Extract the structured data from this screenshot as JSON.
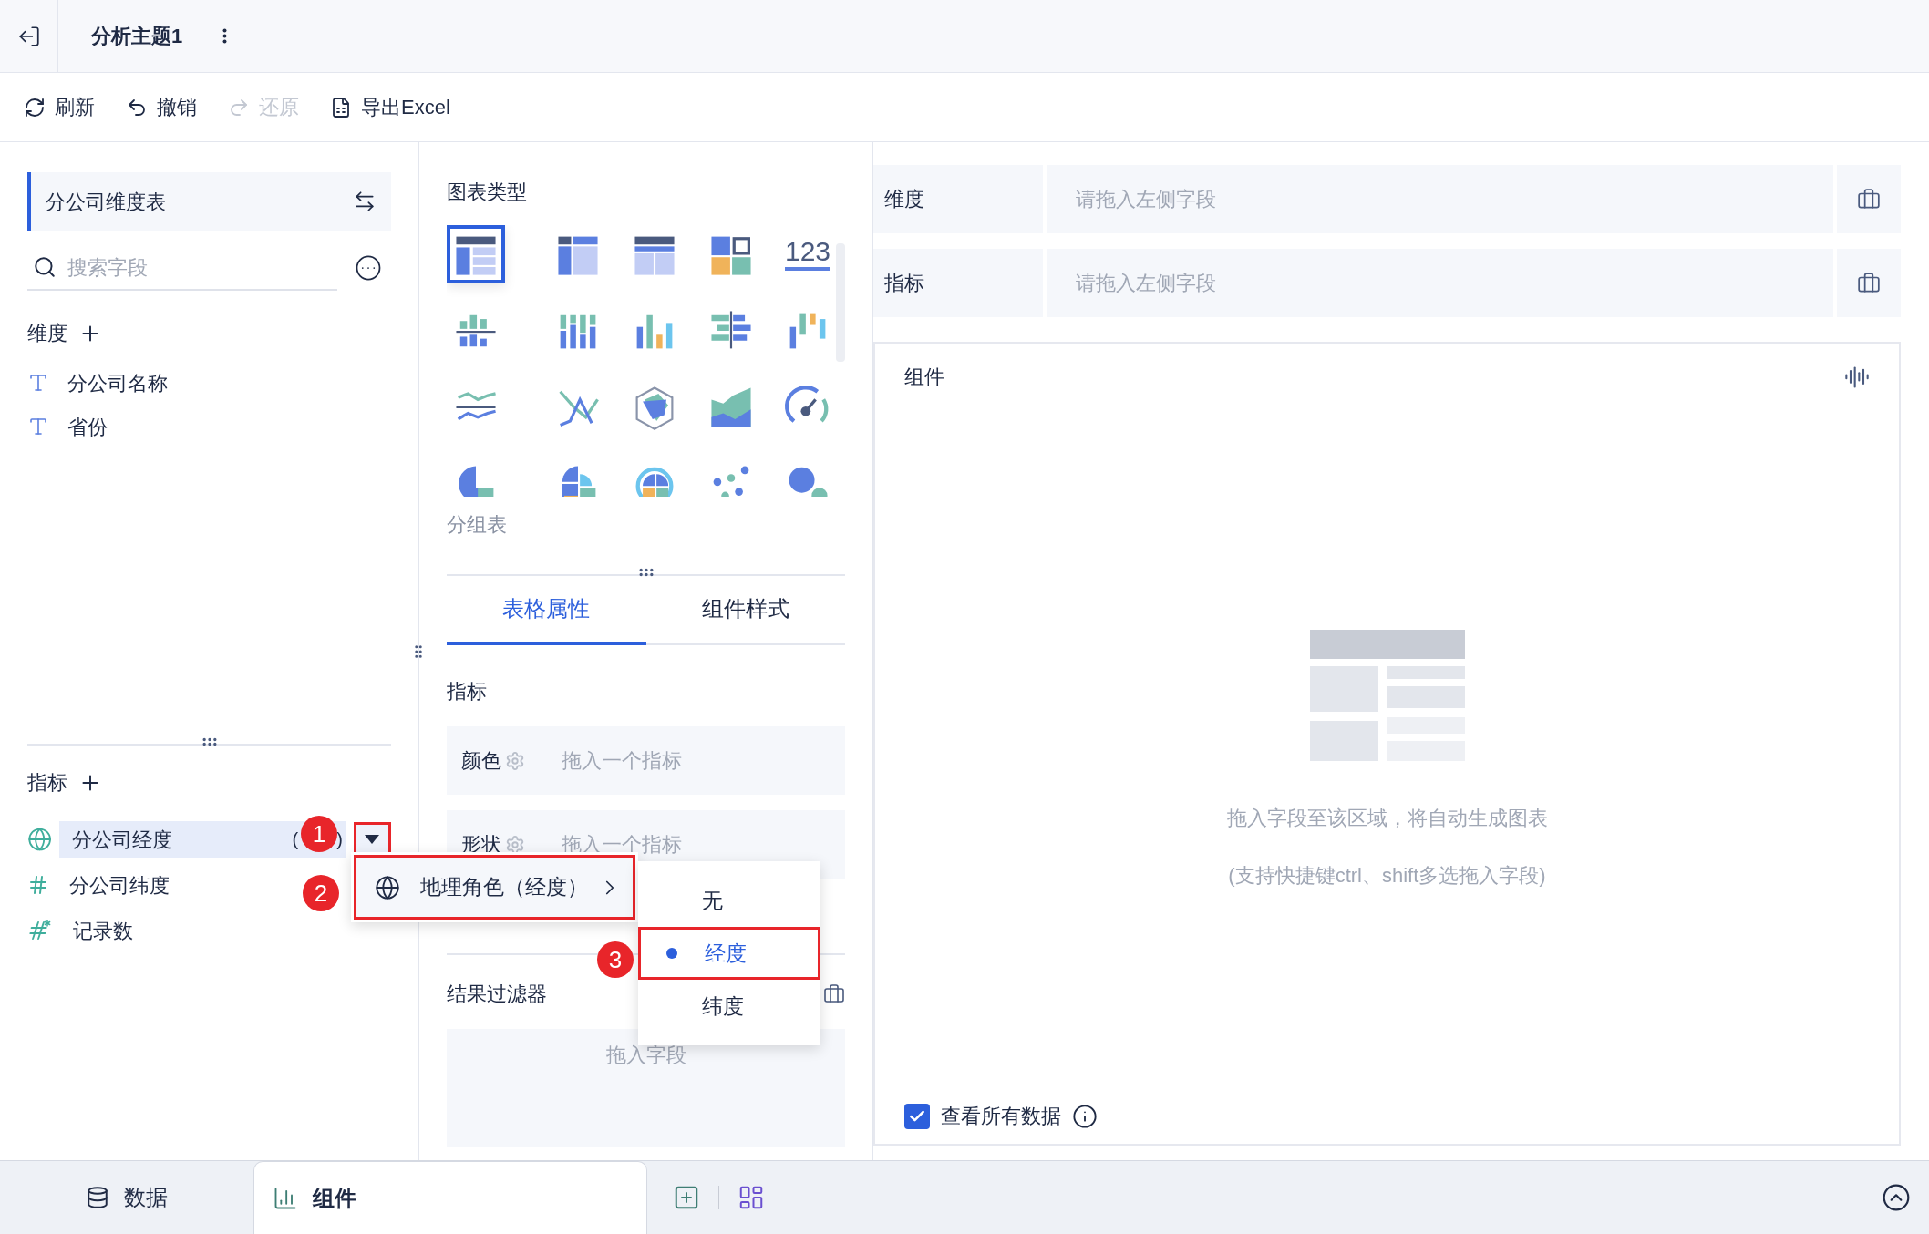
{
  "header": {
    "title": "分析主题1"
  },
  "toolbar": [
    {
      "kind": "refresh",
      "label": "刷新",
      "disabled": false
    },
    {
      "kind": "undo",
      "label": "撤销",
      "disabled": false
    },
    {
      "kind": "redo",
      "label": "还原",
      "disabled": true
    },
    {
      "kind": "excel",
      "label": "导出Excel",
      "disabled": false
    }
  ],
  "fields_panel": {
    "dataset": "分公司维度表",
    "search": {
      "placeholder": "搜索字段"
    },
    "dimensions": {
      "title": "维度",
      "fields": [
        {
          "kind": "text",
          "name": "分公司名称"
        },
        {
          "kind": "text",
          "name": "省份"
        }
      ]
    },
    "measures": {
      "title": "指标",
      "fields": [
        {
          "kind": "geo",
          "name": "分公司经度",
          "suffix_open": "(",
          "suffix_close": ")",
          "selected": true
        },
        {
          "kind": "number",
          "name": "分公司纬度",
          "selected": false
        },
        {
          "kind": "count",
          "name": "记录数",
          "selected": false
        }
      ]
    }
  },
  "chart_types": {
    "title": "图表类型",
    "caption": "分组表",
    "items": [
      {
        "kind": "table",
        "selected": true
      },
      {
        "kind": "crosstab",
        "selected": false
      },
      {
        "kind": "detail",
        "selected": false
      },
      {
        "kind": "card",
        "selected": false
      },
      {
        "kind": "kpi",
        "label": "123",
        "selected": false
      },
      {
        "kind": "bar-split",
        "selected": false
      },
      {
        "kind": "bar-stacked",
        "selected": false
      },
      {
        "kind": "column",
        "selected": false
      },
      {
        "kind": "bar-horizontal",
        "selected": false
      },
      {
        "kind": "waterfall",
        "selected": false
      },
      {
        "kind": "line-compare",
        "selected": false
      },
      {
        "kind": "line-cross",
        "selected": false
      },
      {
        "kind": "radar",
        "selected": false
      },
      {
        "kind": "area",
        "selected": false
      },
      {
        "kind": "gauge",
        "selected": false
      },
      {
        "kind": "pie",
        "selected": false
      },
      {
        "kind": "rose",
        "selected": false
      },
      {
        "kind": "sunburst",
        "selected": false
      },
      {
        "kind": "scatter",
        "selected": false
      },
      {
        "kind": "bubble",
        "selected": false
      }
    ]
  },
  "property_tabs": [
    {
      "label": "表格属性",
      "selected": true
    },
    {
      "label": "组件样式",
      "selected": false
    }
  ],
  "properties": {
    "title": "指标",
    "slots": [
      {
        "label": "颜色",
        "placeholder": "拖入一个指标"
      },
      {
        "label": "形状",
        "placeholder": "拖入一个指标"
      }
    ],
    "result_filter": {
      "title": "结果过滤器",
      "placeholder": "拖入字段"
    }
  },
  "shelves": [
    {
      "label": "维度",
      "placeholder": "请拖入左侧字段"
    },
    {
      "label": "指标",
      "placeholder": "请拖入左侧字段"
    }
  ],
  "component": {
    "title": "组件",
    "empty_text": "拖入字段至该区域，将自动生成图表",
    "hint": "(支持快捷键ctrl、shift多选拖入字段)",
    "view_all": {
      "label": "查看所有数据",
      "checked": true
    }
  },
  "bottom_tabs": [
    {
      "kind": "data",
      "label": "数据",
      "selected": false
    },
    {
      "kind": "component",
      "label": "组件",
      "selected": true
    }
  ],
  "context_menu": {
    "label": "地理角色（经度）"
  },
  "submenu": [
    {
      "label": "无",
      "selected": false
    },
    {
      "label": "经度",
      "selected": true
    },
    {
      "label": "纬度",
      "selected": false
    }
  ],
  "annotations": [
    "1",
    "2",
    "3"
  ]
}
